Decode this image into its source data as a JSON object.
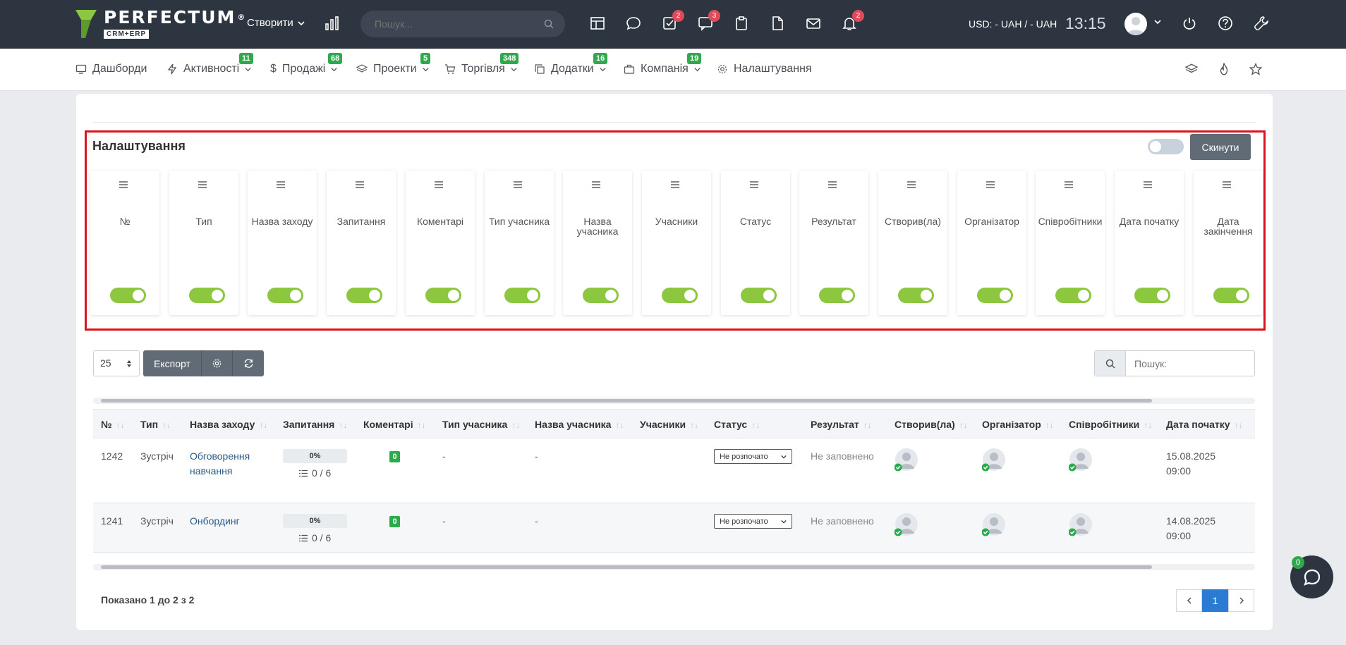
{
  "header": {
    "logo_word": "PERFECTUM",
    "logo_reg": "®",
    "logo_sub": "CRM+ERP",
    "create_label": "Створити",
    "search_placeholder": "Пошук...",
    "icon_badges": {
      "tasks": "2",
      "chat": "3",
      "bell": "2"
    },
    "currency": "USD: - UAH / - UAH",
    "time": "13:15"
  },
  "nav": {
    "items": [
      {
        "label": "Дашборди",
        "badge": ""
      },
      {
        "label": "Активності",
        "badge": "11"
      },
      {
        "label": "Продажі",
        "badge": "68"
      },
      {
        "label": "Проекти",
        "badge": "5"
      },
      {
        "label": "Торгівля",
        "badge": "348"
      },
      {
        "label": "Додатки",
        "badge": "16"
      },
      {
        "label": "Компанія",
        "badge": "19"
      },
      {
        "label": "Налаштування",
        "badge": ""
      }
    ]
  },
  "settings": {
    "title": "Налаштування",
    "reset_label": "Скинути",
    "columns": [
      "№",
      "Тип",
      "Назва заходу",
      "Запитання",
      "Коментарі",
      "Тип учасника",
      "Назва учасника",
      "Учасники",
      "Статус",
      "Результат",
      "Створив(ла)",
      "Організатор",
      "Співробітники",
      "Дата початку",
      "Дата закінчення"
    ]
  },
  "controls": {
    "page_size": "25",
    "export_label": "Експорт",
    "search_placeholder": "Пошук:"
  },
  "table": {
    "headers": [
      "№",
      "Тип",
      "Назва заходу",
      "Запитання",
      "Коментарі",
      "Тип учасника",
      "Назва учасника",
      "Учасники",
      "Статус",
      "Результат",
      "Створив(ла)",
      "Організатор",
      "Співробітники",
      "Дата початку"
    ],
    "rows": [
      {
        "id": "1242",
        "type": "Зустріч",
        "name_line1": "Обговорення",
        "name_line2": "навчання",
        "progress": "0%",
        "questions": "0 / 6",
        "comments": "0",
        "participant_type": "-",
        "participant_name": "-",
        "status": "Не розпочато",
        "result": "Не заповнено",
        "date": "15.08.2025",
        "time": "09:00"
      },
      {
        "id": "1241",
        "type": "Зустріч",
        "name_line1": "Онбординг",
        "name_line2": "",
        "progress": "0%",
        "questions": "0 / 6",
        "comments": "0",
        "participant_type": "-",
        "participant_name": "-",
        "status": "Не розпочато",
        "result": "Не заповнено",
        "date": "14.08.2025",
        "time": "09:00"
      }
    ]
  },
  "footer": {
    "info": "Показано 1 до 2 з 2",
    "current_page": "1"
  },
  "chat": {
    "badge": "0"
  },
  "colors": {
    "topbar": "#2d3540",
    "accent_green": "#8dc63f",
    "badge_green": "#2eaa4d",
    "badge_red": "#e04b5a",
    "highlight": "#d9141f"
  }
}
